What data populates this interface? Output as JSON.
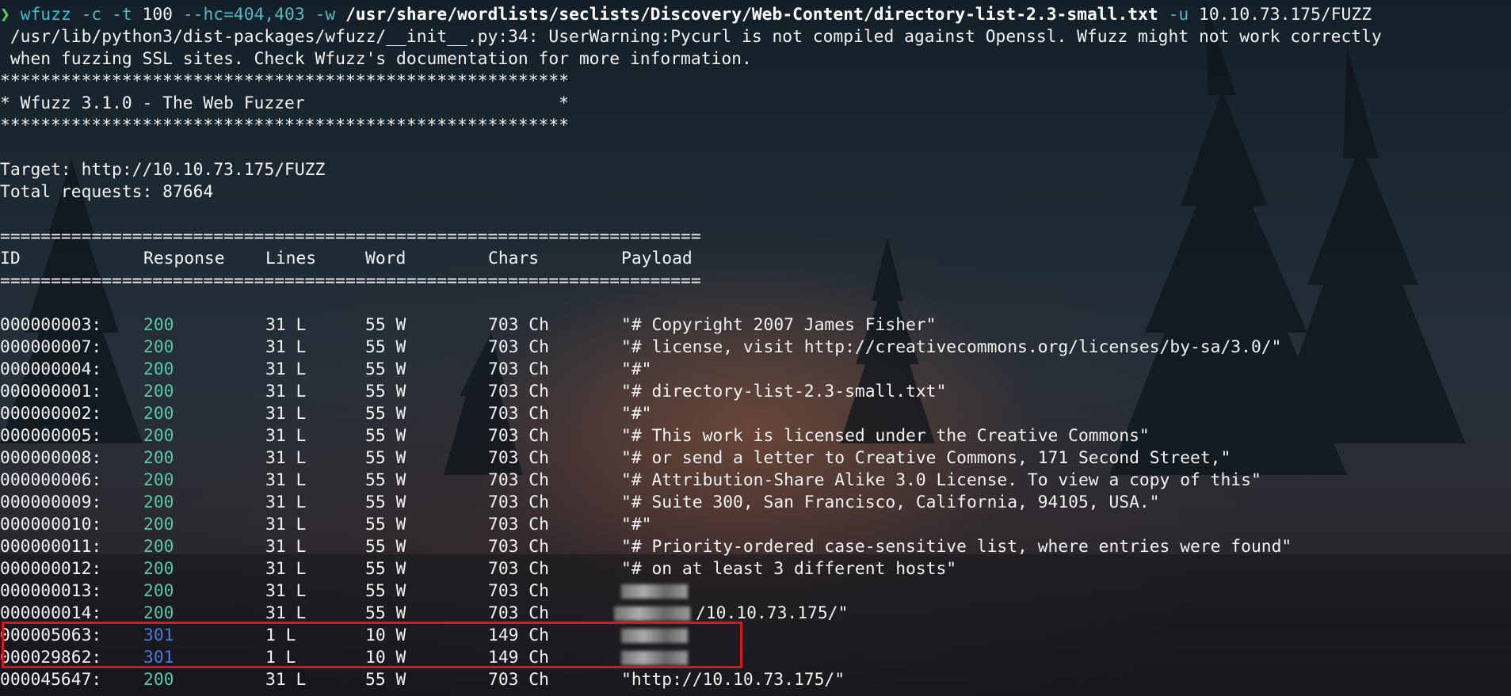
{
  "command": {
    "prompt": "❯",
    "tool": "wfuzz",
    "opts1": "-c -t",
    "threads": "100",
    "opts2": "--hc=404,403 -w",
    "wordlist": "/usr/share/wordlists/seclists/Discovery/Web-Content/directory-list-2.3-small.txt",
    "opt_u": "-u",
    "url": "10.10.73.175/FUZZ"
  },
  "warning": [
    " /usr/lib/python3/dist-packages/wfuzz/__init__.py:34: UserWarning:Pycurl is not compiled against Openssl. Wfuzz might not work correctly",
    " when fuzzing SSL sites. Check Wfuzz's documentation for more information."
  ],
  "banner": [
    "********************************************************",
    "* Wfuzz 3.1.0 - The Web Fuzzer                         *",
    "********************************************************"
  ],
  "target": "Target: http://10.10.73.175/FUZZ",
  "total": "Total requests: 87664",
  "separator": "=====================================================================",
  "headers": {
    "id": "ID",
    "response": "Response",
    "lines": "Lines",
    "word": "Word",
    "chars": "Chars",
    "payload": "Payload"
  },
  "rows": [
    {
      "id": "000000003:",
      "resp": "200",
      "lines": "31 L",
      "word": "55 W",
      "chars": "703 Ch",
      "payload": "\"# Copyright 2007 James Fisher\""
    },
    {
      "id": "000000007:",
      "resp": "200",
      "lines": "31 L",
      "word": "55 W",
      "chars": "703 Ch",
      "payload": "\"# license, visit http://creativecommons.org/licenses/by-sa/3.0/\""
    },
    {
      "id": "000000004:",
      "resp": "200",
      "lines": "31 L",
      "word": "55 W",
      "chars": "703 Ch",
      "payload": "\"#\""
    },
    {
      "id": "000000001:",
      "resp": "200",
      "lines": "31 L",
      "word": "55 W",
      "chars": "703 Ch",
      "payload": "\"# directory-list-2.3-small.txt\""
    },
    {
      "id": "000000002:",
      "resp": "200",
      "lines": "31 L",
      "word": "55 W",
      "chars": "703 Ch",
      "payload": "\"#\""
    },
    {
      "id": "000000005:",
      "resp": "200",
      "lines": "31 L",
      "word": "55 W",
      "chars": "703 Ch",
      "payload": "\"# This work is licensed under the Creative Commons\""
    },
    {
      "id": "000000008:",
      "resp": "200",
      "lines": "31 L",
      "word": "55 W",
      "chars": "703 Ch",
      "payload": "\"# or send a letter to Creative Commons, 171 Second Street,\""
    },
    {
      "id": "000000006:",
      "resp": "200",
      "lines": "31 L",
      "word": "55 W",
      "chars": "703 Ch",
      "payload": "\"# Attribution-Share Alike 3.0 License. To view a copy of this\""
    },
    {
      "id": "000000009:",
      "resp": "200",
      "lines": "31 L",
      "word": "55 W",
      "chars": "703 Ch",
      "payload": "\"# Suite 300, San Francisco, California, 94105, USA.\""
    },
    {
      "id": "000000010:",
      "resp": "200",
      "lines": "31 L",
      "word": "55 W",
      "chars": "703 Ch",
      "payload": "\"#\""
    },
    {
      "id": "000000011:",
      "resp": "200",
      "lines": "31 L",
      "word": "55 W",
      "chars": "703 Ch",
      "payload": "\"# Priority-ordered case-sensitive list, where entries were found\""
    },
    {
      "id": "000000012:",
      "resp": "200",
      "lines": "31 L",
      "word": "55 W",
      "chars": "703 Ch",
      "payload": "\"# on at least 3 different hosts\""
    },
    {
      "id": "000000013:",
      "resp": "200",
      "lines": "31 L",
      "word": "55 W",
      "chars": "703 Ch",
      "payload": ""
    },
    {
      "id": "000000014:",
      "resp": "200",
      "lines": "31 L",
      "word": "55 W",
      "chars": "703 Ch",
      "payload": "/10.10.73.175/\""
    },
    {
      "id": "000005063:",
      "resp": "301",
      "lines": "1 L",
      "word": "10 W",
      "chars": "149 Ch",
      "payload": ""
    },
    {
      "id": "000029862:",
      "resp": "301",
      "lines": "1 L",
      "word": "10 W",
      "chars": "149 Ch",
      "payload": ""
    },
    {
      "id": "000045647:",
      "resp": "200",
      "lines": "31 L",
      "word": "55 W",
      "chars": "703 Ch",
      "payload": "\"http://10.10.73.175/\""
    }
  ]
}
